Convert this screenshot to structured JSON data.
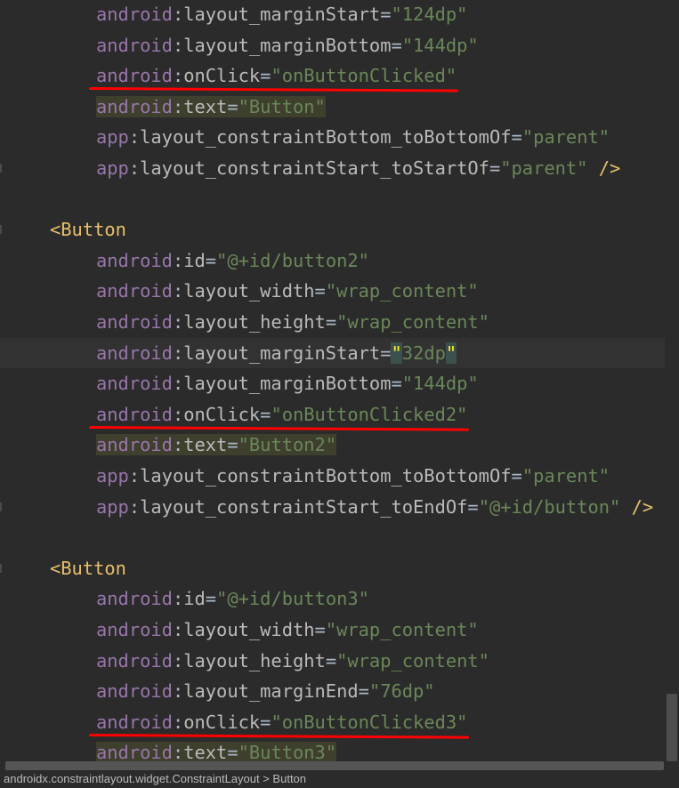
{
  "editor": {
    "lines": [
      {
        "kind": "attr",
        "ns": "android",
        "name": "layout_marginStart",
        "value": "\"124dp\""
      },
      {
        "kind": "attr",
        "ns": "android",
        "name": "layout_marginBottom",
        "value": "\"144dp\""
      },
      {
        "kind": "attr",
        "ns": "android",
        "name": "onClick",
        "value": "\"onButtonClicked\"",
        "underline": true
      },
      {
        "kind": "attr",
        "ns": "android",
        "name": "text",
        "value": "\"Button\"",
        "highlight": true
      },
      {
        "kind": "attr",
        "ns": "app",
        "name": "layout_constraintBottom_toBottomOf",
        "value": "\"parent\""
      },
      {
        "kind": "attr",
        "ns": "app",
        "name": "layout_constraintStart_toStartOf",
        "value": "\"parent\"",
        "close": " />"
      },
      {
        "kind": "blank"
      },
      {
        "kind": "tag",
        "text": "<Button"
      },
      {
        "kind": "attr",
        "ns": "android",
        "name": "id",
        "value": "\"@+id/button2\""
      },
      {
        "kind": "attr",
        "ns": "android",
        "name": "layout_width",
        "value": "\"wrap_content\""
      },
      {
        "kind": "attr",
        "ns": "android",
        "name": "layout_height",
        "value": "\"wrap_content\""
      },
      {
        "kind": "attr",
        "ns": "android",
        "name": "layout_marginStart",
        "value": "\"32dp\"",
        "current": true,
        "bracket": true
      },
      {
        "kind": "attr",
        "ns": "android",
        "name": "layout_marginBottom",
        "value": "\"144dp\""
      },
      {
        "kind": "attr",
        "ns": "android",
        "name": "onClick",
        "value": "\"onButtonClicked2\"",
        "underline": true
      },
      {
        "kind": "attr",
        "ns": "android",
        "name": "text",
        "value": "\"Button2\"",
        "highlight": true
      },
      {
        "kind": "attr",
        "ns": "app",
        "name": "layout_constraintBottom_toBottomOf",
        "value": "\"parent\""
      },
      {
        "kind": "attr",
        "ns": "app",
        "name": "layout_constraintStart_toEndOf",
        "value": "\"@+id/button\"",
        "close": " />"
      },
      {
        "kind": "blank"
      },
      {
        "kind": "tag",
        "text": "<Button"
      },
      {
        "kind": "attr",
        "ns": "android",
        "name": "id",
        "value": "\"@+id/button3\""
      },
      {
        "kind": "attr",
        "ns": "android",
        "name": "layout_width",
        "value": "\"wrap_content\""
      },
      {
        "kind": "attr",
        "ns": "android",
        "name": "layout_height",
        "value": "\"wrap_content\""
      },
      {
        "kind": "attr",
        "ns": "android",
        "name": "layout_marginEnd",
        "value": "\"76dp\""
      },
      {
        "kind": "attr",
        "ns": "android",
        "name": "onClick",
        "value": "\"onButtonClicked3\"",
        "underline": true
      },
      {
        "kind": "attr",
        "ns": "android",
        "name": "text",
        "value": "\"Button3\"",
        "highlight": true
      }
    ],
    "colors": {
      "background": "#2b2b2b",
      "namespace": "#9876aa",
      "value": "#6a8759",
      "tag": "#e8bf6a",
      "underline": "#ff0000"
    }
  },
  "breadcrumb": {
    "text": "androidx.constraintlayout.widget.ConstraintLayout  >  Button"
  }
}
